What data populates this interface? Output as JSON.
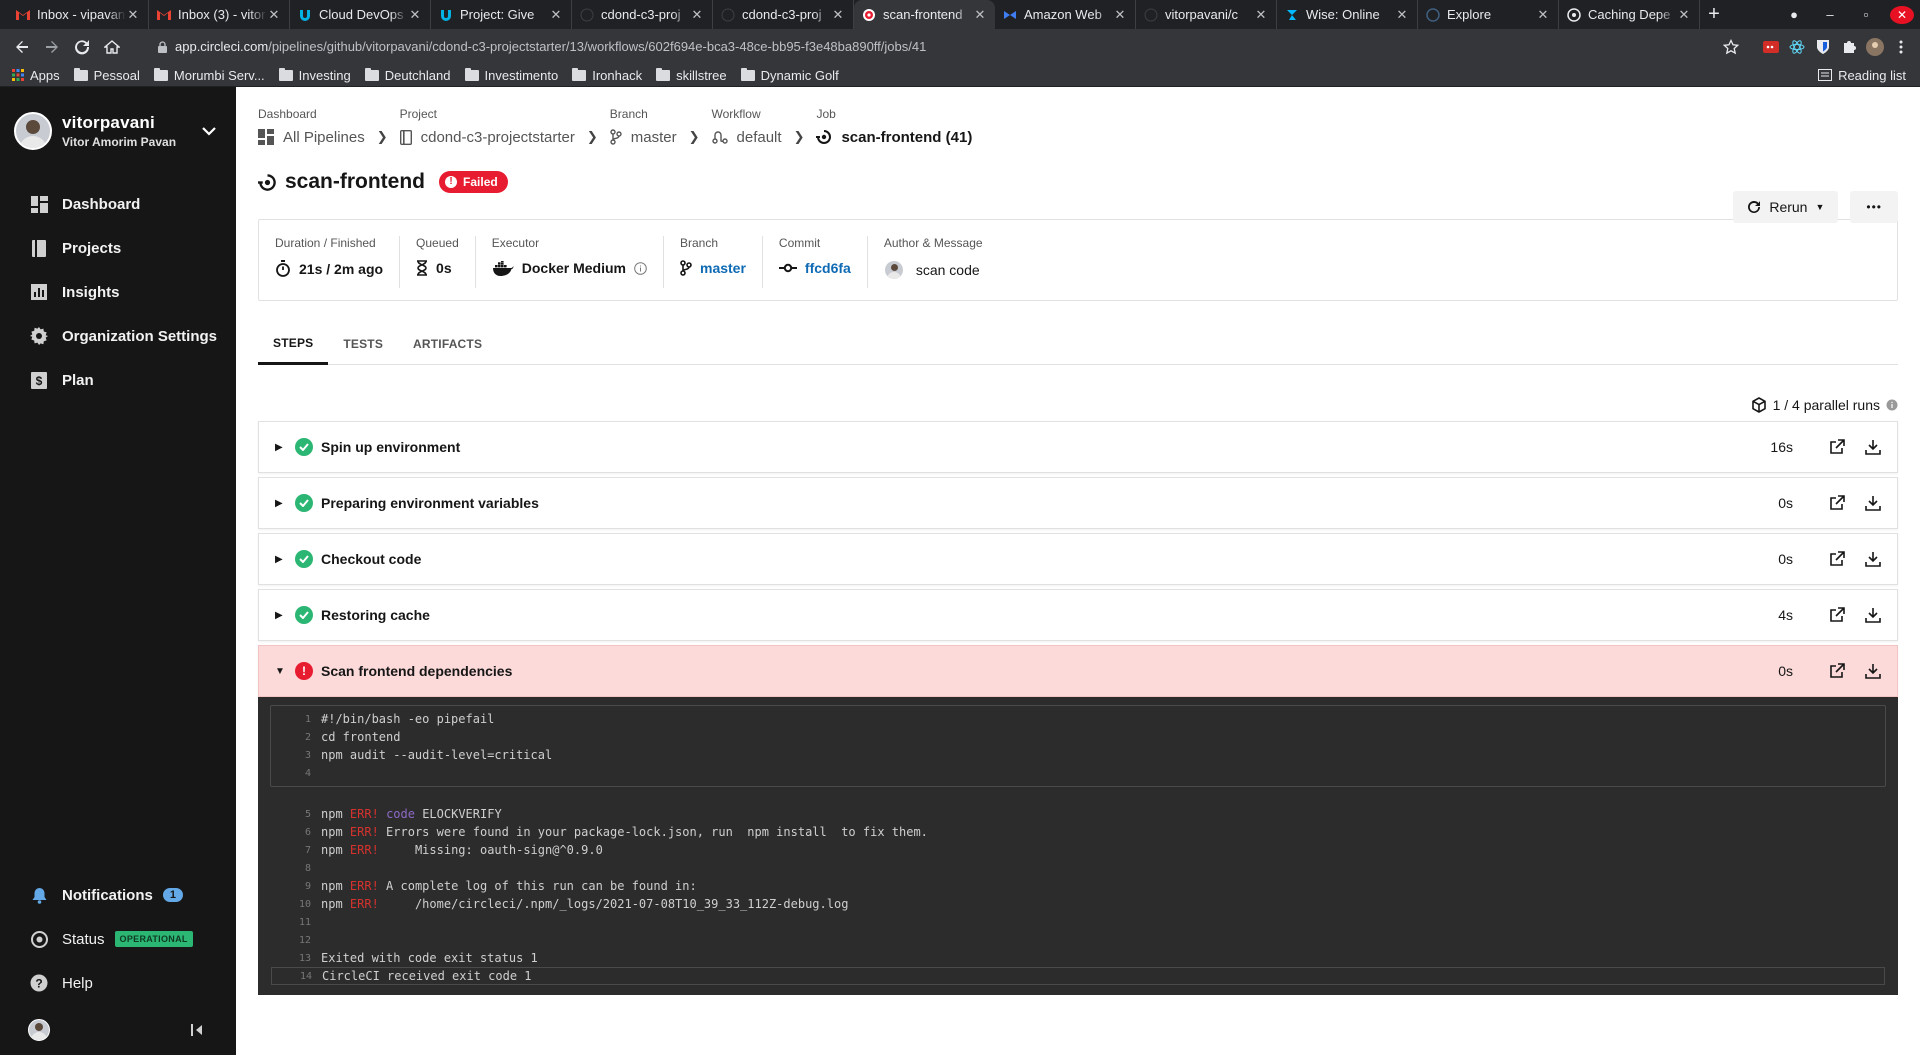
{
  "browser": {
    "tabs": [
      {
        "title": "Inbox - vipavani",
        "icon": "gmail-icon",
        "active": false
      },
      {
        "title": "Inbox (3) - vitor",
        "icon": "gmail-icon",
        "active": false
      },
      {
        "title": "Cloud DevOps",
        "icon": "udacity-icon",
        "active": false
      },
      {
        "title": "Project: Give",
        "icon": "udacity-icon",
        "active": false
      },
      {
        "title": "cdond-c3-proj",
        "icon": "github-icon",
        "active": false
      },
      {
        "title": "cdond-c3-proj",
        "icon": "github-icon",
        "active": false
      },
      {
        "title": "scan-frontend",
        "icon": "circleci-icon",
        "active": true
      },
      {
        "title": "Amazon Web",
        "icon": "aws-icon",
        "active": false
      },
      {
        "title": "vitorpavani/c",
        "icon": "github-icon",
        "active": false
      },
      {
        "title": "Wise: Online",
        "icon": "wise-icon",
        "active": false
      },
      {
        "title": "Explore",
        "icon": "globe-icon",
        "active": false
      },
      {
        "title": "Caching Depe",
        "icon": "circleci-icon",
        "active": false
      }
    ],
    "url_host": "app.circleci.com",
    "url_path": "/pipelines/github/vitorpavani/cdond-c3-projectstarter/13/workflows/602f694e-bca3-48ce-bb95-f3e48ba890ff/jobs/41",
    "bookmarks": [
      "Apps",
      "Pessoal",
      "Morumbi Serv...",
      "Investing",
      "Deutchland",
      "Investimento",
      "Ironhack",
      "skillstree",
      "Dynamic Golf"
    ],
    "reading_list": "Reading list"
  },
  "sidebar": {
    "username": "vitorpavani",
    "fullname": "Vitor Amorim Pavan",
    "nav": [
      {
        "label": "Dashboard",
        "icon": "dashboard-icon"
      },
      {
        "label": "Projects",
        "icon": "projects-icon"
      },
      {
        "label": "Insights",
        "icon": "insights-icon"
      },
      {
        "label": "Organization Settings",
        "icon": "gear-icon"
      },
      {
        "label": "Plan",
        "icon": "plan-icon"
      }
    ],
    "notifications_label": "Notifications",
    "notifications_count": "1",
    "status_label": "Status",
    "status_badge": "OPERATIONAL",
    "help_label": "Help"
  },
  "breadcrumb": {
    "dashboard_label": "Dashboard",
    "dashboard_value": "All Pipelines",
    "project_label": "Project",
    "project_value": "cdond-c3-projectstarter",
    "branch_label": "Branch",
    "branch_value": "master",
    "workflow_label": "Workflow",
    "workflow_value": "default",
    "job_label": "Job",
    "job_value": "scan-frontend (41)"
  },
  "job": {
    "title": "scan-frontend",
    "status": "Failed",
    "rerun_label": "Rerun",
    "more_label": "•••"
  },
  "info": {
    "duration_label": "Duration / Finished",
    "duration_value": "21s / 2m ago",
    "queued_label": "Queued",
    "queued_value": "0s",
    "executor_label": "Executor",
    "executor_value": "Docker Medium",
    "branch_label": "Branch",
    "branch_value": "master",
    "commit_label": "Commit",
    "commit_value": "ffcd6fa",
    "author_label": "Author & Message",
    "author_message": "scan code"
  },
  "tabs": [
    "STEPS",
    "TESTS",
    "ARTIFACTS"
  ],
  "parallel_runs": "1 / 4 parallel runs",
  "steps": [
    {
      "name": "Spin up environment",
      "duration": "16s",
      "status": "success"
    },
    {
      "name": "Preparing environment variables",
      "duration": "0s",
      "status": "success"
    },
    {
      "name": "Checkout code",
      "duration": "0s",
      "status": "success"
    },
    {
      "name": "Restoring cache",
      "duration": "4s",
      "status": "success"
    },
    {
      "name": "Scan frontend dependencies",
      "duration": "0s",
      "status": "failed"
    }
  ],
  "console": {
    "lines": {
      "l1": "#!/bin/bash -eo pipefail",
      "l2": "cd frontend",
      "l3": "npm audit --audit-level=critical",
      "l4": "",
      "npm": "npm",
      "err": "ERR!",
      "code_kw": "code",
      "l5_rest": " ELOCKVERIFY",
      "l6_rest": " Errors were found in your package-lock.json, run  npm install  to fix them.",
      "l7_rest": "     Missing: oauth-sign@^0.9.0",
      "l9_rest": " A complete log of this run can be found in:",
      "l10_rest": "     /home/circleci/.npm/_logs/2021-07-08T10_39_33_112Z-debug.log",
      "l13": "Exited with code exit status 1",
      "l14": "CircleCI received exit code 1"
    },
    "numbers": [
      "1",
      "2",
      "3",
      "4",
      "5",
      "6",
      "7",
      "8",
      "9",
      "10",
      "11",
      "12",
      "13",
      "14"
    ]
  },
  "colors": {
    "success": "#2bb673",
    "failed": "#e81c30",
    "sidebar": "#161616",
    "link": "#0f6ab4"
  }
}
